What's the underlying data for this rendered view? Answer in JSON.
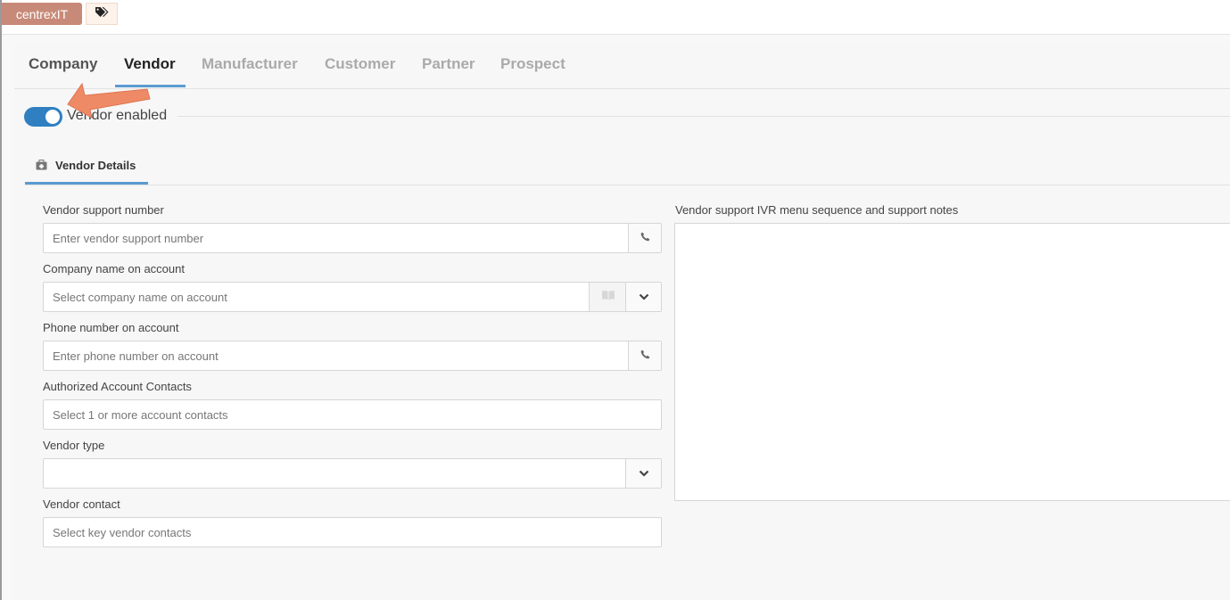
{
  "header": {
    "tag_label": "centrexIT",
    "tags_icon": "tags-icon"
  },
  "tabs": [
    {
      "label": "Company",
      "state": "default"
    },
    {
      "label": "Vendor",
      "state": "active"
    },
    {
      "label": "Manufacturer",
      "state": "inactive"
    },
    {
      "label": "Customer",
      "state": "inactive"
    },
    {
      "label": "Partner",
      "state": "inactive"
    },
    {
      "label": "Prospect",
      "state": "inactive"
    }
  ],
  "vendor_toggle": {
    "label": "Vendor enabled",
    "enabled": true
  },
  "section": {
    "title": "Vendor Details",
    "icon": "briefcase-medical-icon"
  },
  "form": {
    "support_number": {
      "label": "Vendor support number",
      "placeholder": "Enter vendor support number",
      "value": "",
      "addon_icon": "phone-icon"
    },
    "company_name": {
      "label": "Company name on account",
      "placeholder": "Select company name on account",
      "value": "",
      "addon_icons": [
        "address-book-icon",
        "chevron-down-icon"
      ]
    },
    "phone_number": {
      "label": "Phone number on account",
      "placeholder": "Enter phone number on account",
      "value": "",
      "addon_icon": "phone-icon"
    },
    "authorized_contacts": {
      "label": "Authorized Account Contacts",
      "placeholder": "Select 1 or more account contacts",
      "value": ""
    },
    "vendor_type": {
      "label": "Vendor type",
      "value": "",
      "addon_icon": "chevron-down-icon"
    },
    "vendor_contact": {
      "label": "Vendor contact",
      "placeholder": "Select key vendor contacts",
      "value": ""
    },
    "ivr_notes": {
      "label": "Vendor support IVR menu sequence and support notes",
      "value": ""
    }
  },
  "colors": {
    "accent": "#2f7fc1",
    "tab_underline": "#5b9bd1",
    "tag_background": "#c88a78",
    "annotation_arrow": "#ee8a66"
  }
}
